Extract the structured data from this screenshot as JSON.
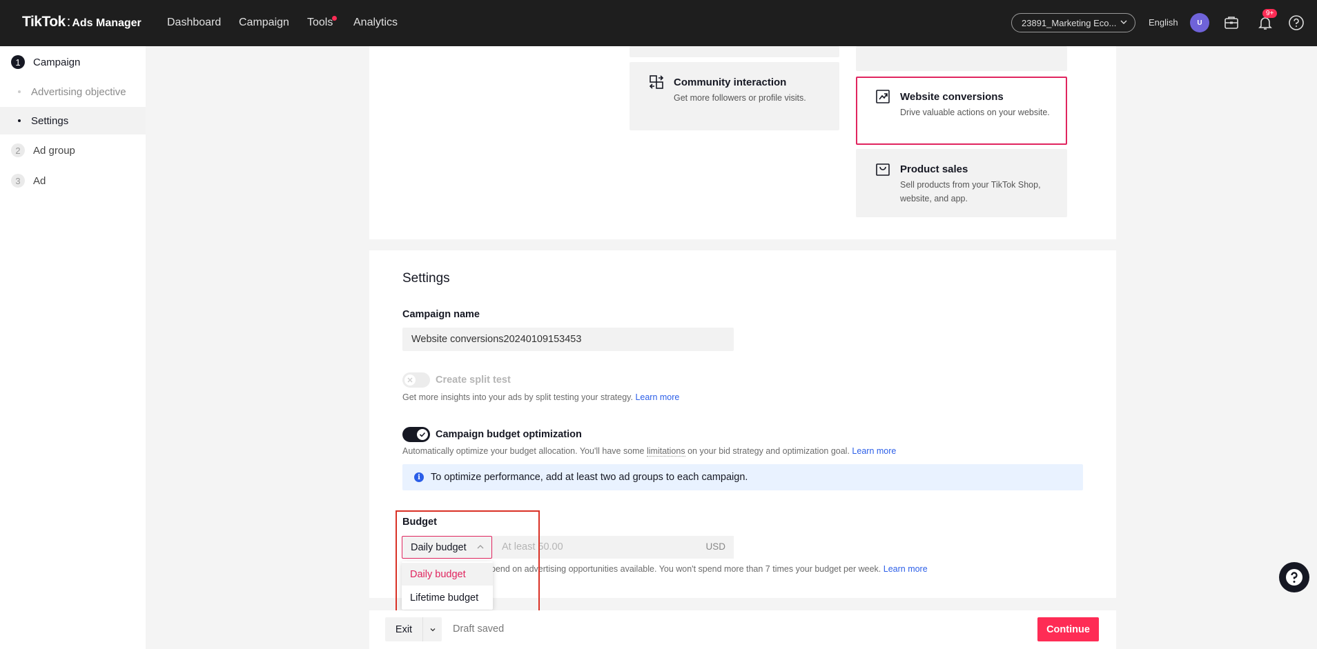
{
  "app": {
    "logo_main": "TikTok",
    "logo_sep": ":",
    "logo_sub": "Ads Manager"
  },
  "topnav": {
    "items": [
      "Dashboard",
      "Campaign",
      "Tools",
      "Analytics"
    ],
    "account": "23891_Marketing Eco...",
    "language": "English",
    "avatar_initial": "U",
    "notification_badge": "9+"
  },
  "sidebar": {
    "steps": [
      {
        "num": "1",
        "label": "Campaign"
      },
      {
        "num": "2",
        "label": "Ad group"
      },
      {
        "num": "3",
        "label": "Ad"
      }
    ],
    "substeps": [
      "Advertising objective",
      "Settings"
    ]
  },
  "objectives": [
    {
      "title": "Community interaction",
      "desc": "Get more followers or profile visits.",
      "icon": "community-icon"
    },
    {
      "title": "Website conversions",
      "desc": "Drive valuable actions on your website.",
      "icon": "trend-up-icon",
      "selected": true
    },
    {
      "title": "Product sales",
      "desc": "Sell products from your TikTok Shop, website, and app.",
      "icon": "shopping-bag-icon"
    }
  ],
  "settings": {
    "title": "Settings",
    "campaign_name_label": "Campaign name",
    "campaign_name_value": "Website conversions20240109153453",
    "split_test_label": "Create split test",
    "split_test_help": "Get more insights into your ads by split testing your strategy.",
    "learn_more": "Learn more",
    "cbo_label": "Campaign budget optimization",
    "cbo_help_pre": "Automatically optimize your budget allocation. You'll have some",
    "cbo_help_link": "limitations",
    "cbo_help_post": "on your bid strategy and optimization goal.",
    "info_banner": "To optimize performance, add at least two ad groups to each campaign.",
    "budget_label": "Budget",
    "budget_type": "Daily budget",
    "budget_placeholder": "At least 50.00",
    "budget_currency": "USD",
    "budget_help": "pend on advertising opportunities available. You won't spend more than 7 times your budget per week.",
    "dropdown_options": [
      "Daily budget",
      "Lifetime budget"
    ]
  },
  "footer": {
    "exit_label": "Exit",
    "draft_status": "Draft saved",
    "continue_label": "Continue"
  },
  "colors": {
    "brand": "#fe2c55",
    "selected_border": "#e0245e",
    "link": "#2b5ee8",
    "highlight_box": "#d93025"
  }
}
